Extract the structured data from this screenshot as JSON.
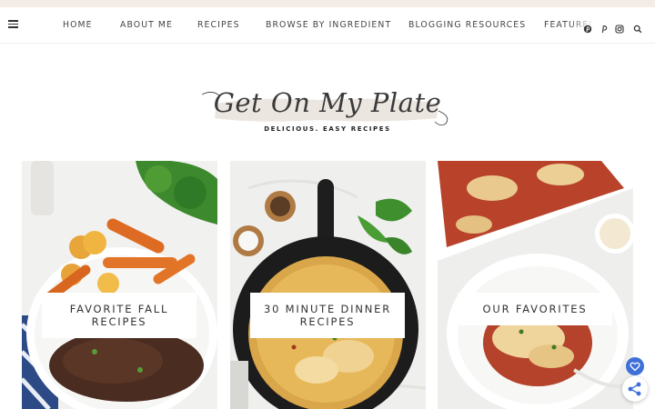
{
  "nav": {
    "items": [
      "HOME",
      "ABOUT ME",
      "RECIPES",
      "BROWSE BY INGREDIENT",
      "BLOGGING RESOURCES",
      "FEATURED"
    ],
    "social_icons": [
      "pinterest-icon",
      "pinterest-p-icon",
      "instagram-icon",
      "search-icon"
    ]
  },
  "logo": {
    "title": "Get On My Plate",
    "tagline": "DELICIOUS. EASY RECIPES"
  },
  "cards": [
    {
      "label": "FAVORITE FALL RECIPES"
    },
    {
      "label": "30 MINUTE DINNER RECIPES"
    },
    {
      "label": "OUR FAVORITES"
    }
  ],
  "floating": {
    "heart_icon": "heart-icon",
    "share_icon": "share-icon",
    "accent": "#3f6fd8"
  }
}
